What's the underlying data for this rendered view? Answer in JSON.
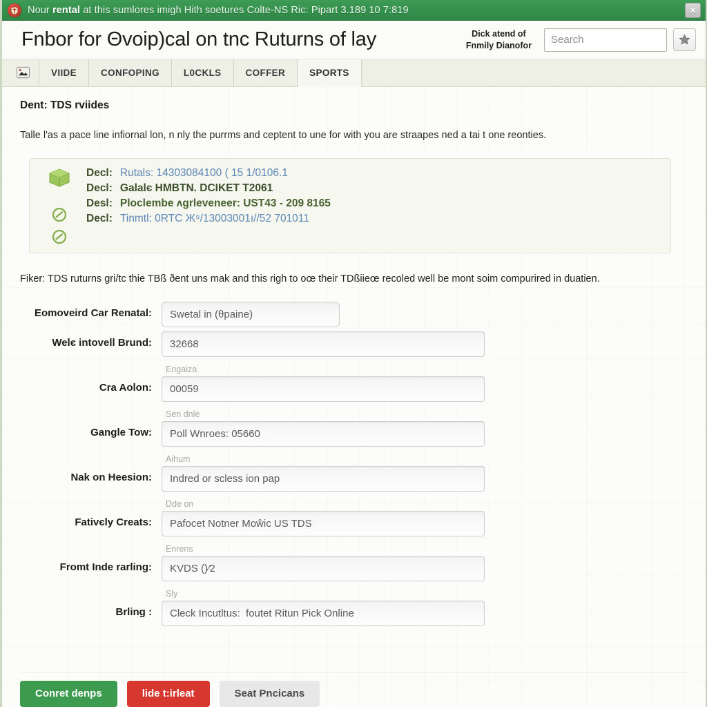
{
  "titlebar": {
    "app_icon": "shield-icon",
    "text_before": "Nour ",
    "text_bold": "rental",
    "text_after": " at this sumlores imigh Hith soetures  Colte-NS Ric: Pipart 3.189 10 7:819",
    "close_label": "×",
    "bg_color": "#35924d"
  },
  "header": {
    "page_title": "Fnbor for Θvoip)cal on tnc Ruturns of lay",
    "note_line1": "Dick atend of",
    "note_line2": "Fnmily Dianofor",
    "search_placeholder": "Search",
    "search_value": "",
    "star_icon": "star-icon"
  },
  "tabs": {
    "home_icon": "page-icon",
    "items": [
      {
        "label": "VIIDE",
        "active": false
      },
      {
        "label": "CONFOPING",
        "active": false
      },
      {
        "label": "L0CKLS",
        "active": false
      },
      {
        "label": "COFFER",
        "active": false
      },
      {
        "label": "SPORTS",
        "active": true
      }
    ]
  },
  "content": {
    "section_title": "Dent: TDS rviides",
    "intro_paragraph": "Talle l'as a pace line infiornal lon, n nly the purrms and ceptent to une for with you are straapes ned a tai t one reonties.",
    "note_paragraph": "Fiker: TDS ruturns gri/tc thie TBß ðent uns mak and this righ to oœ their TDßiieœ recoled well be mont soim compurired in duatien."
  },
  "infobox": {
    "icons": [
      "box-icon",
      "blank-icon",
      "no-entry-icon",
      "no-entry-icon"
    ],
    "lines": [
      {
        "key": "Decl:",
        "value": "Rutals: 14303084100 ( 15 1/0106.1",
        "style": "blue"
      },
      {
        "key": "Decl:",
        "value": "Galalє HMBTN. DCIKET T2061",
        "style": "dark"
      },
      {
        "key": "Desl:",
        "value": "Ploclembe ʌgrleveneer: UST43 - 209 8165",
        "style": "bold"
      },
      {
        "key": "Decl:",
        "value": "Tinmtl: 0RTC Ж⁹/13003001ı//52 701011",
        "style": "blue"
      }
    ]
  },
  "form": {
    "rows": [
      {
        "label": "Eomoveird Car Renatal:",
        "hint": "",
        "value": "Swetal in (θpaine)",
        "narrow": true
      },
      {
        "label": "Welє intovell Brund:",
        "hint": "",
        "value": "32668",
        "narrow": false
      },
      {
        "label": "Cra Aolon:",
        "hint": "Engaiza",
        "value": "00059",
        "narrow": false
      },
      {
        "label": "Gangle Tow:",
        "hint": "Sen dnle",
        "value": "Poll Wnroes: 05660",
        "narrow": false
      },
      {
        "label": "Nak on Heesion:",
        "hint": "Aihum",
        "value": "Indred or scless ion pap",
        "narrow": false
      },
      {
        "label": "Fativєly Creats:",
        "hint": "Dde on",
        "value": "Pafocet Notner Moŵic US TDS",
        "narrow": false
      },
      {
        "label": "Fromt Inde rarling:",
        "hint": "Enrens",
        "value": "KVDS ()⁄2",
        "narrow": false
      },
      {
        "label": "Brling :",
        "hint": "Sly",
        "value": "Cleck Incutltus:  foutet Ritun Pick Online",
        "narrow": false
      }
    ]
  },
  "footer": {
    "buttons": [
      {
        "label": "Conret denps",
        "kind": "primary"
      },
      {
        "label": "lide t:irleat",
        "kind": "danger"
      },
      {
        "label": "Seat Pncicans",
        "kind": "default"
      }
    ]
  },
  "colors": {
    "title_green": "#35924d",
    "primary_green": "#3d9b4f",
    "danger_red": "#d6382f",
    "neutral_gray": "#e8e8e8",
    "info_bg": "#f6f8ef",
    "page_bg": "#fcfcfa"
  }
}
